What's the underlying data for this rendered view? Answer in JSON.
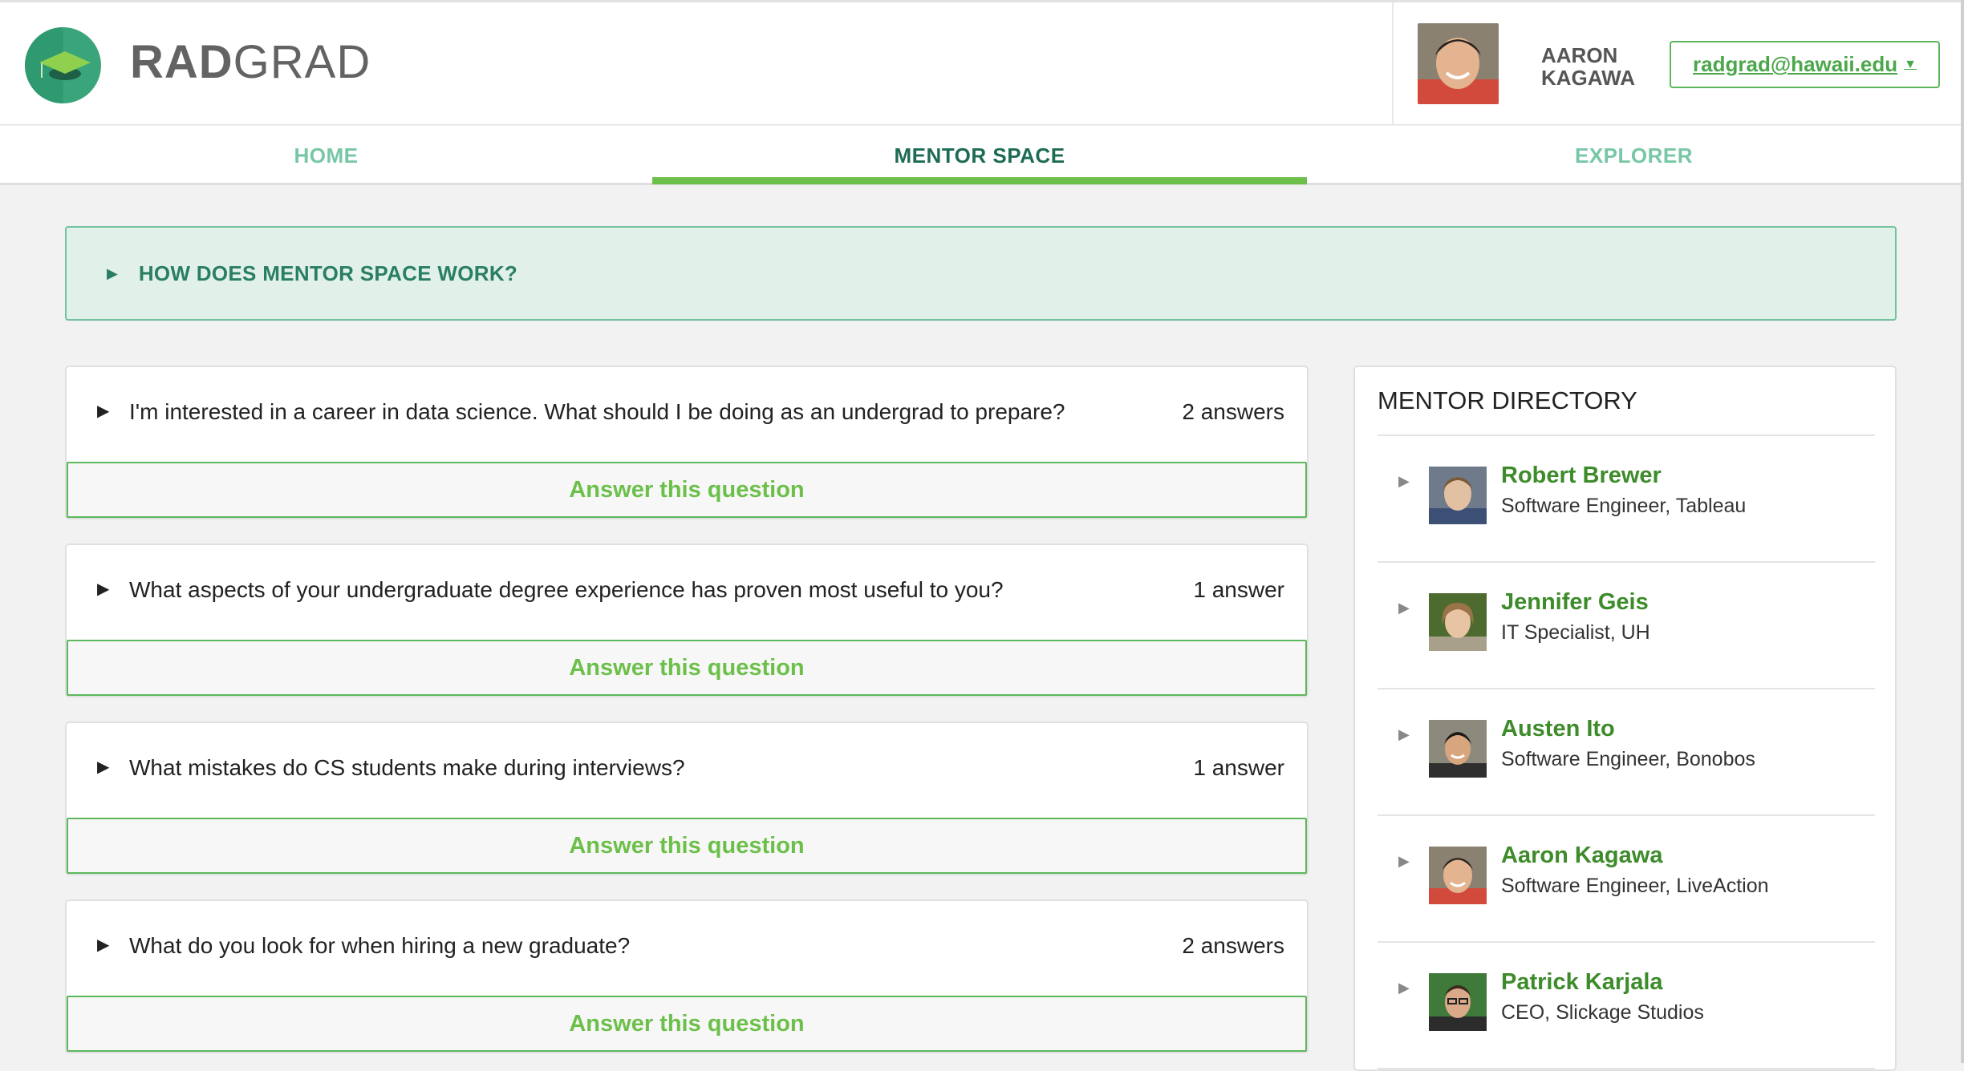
{
  "brand": {
    "name_bold": "RAD",
    "name_rest": "GRAD"
  },
  "user": {
    "name": "AARON\nKAGAWA",
    "email": "radgrad@hawaii.edu"
  },
  "tabs": [
    {
      "label": "HOME",
      "active": false
    },
    {
      "label": "MENTOR SPACE",
      "active": true
    },
    {
      "label": "EXPLORER",
      "active": false
    }
  ],
  "how": {
    "label": "HOW DOES MENTOR SPACE WORK?"
  },
  "questions": [
    {
      "text": "I'm interested in a career in data science. What should I be doing as an undergrad to prepare?",
      "count": "2 answers",
      "button": "Answer this question"
    },
    {
      "text": "What aspects of your undergraduate degree experience has proven most useful to you?",
      "count": "1 answer",
      "button": "Answer this question"
    },
    {
      "text": "What mistakes do CS students make during interviews?",
      "count": "1 answer",
      "button": "Answer this question"
    },
    {
      "text": "What do you look for when hiring a new graduate?",
      "count": "2 answers",
      "button": "Answer this question"
    }
  ],
  "directory": {
    "title": "MENTOR DIRECTORY",
    "mentors": [
      {
        "name": "Robert Brewer",
        "title": "Software Engineer, Tableau"
      },
      {
        "name": "Jennifer Geis",
        "title": "IT Specialist, UH"
      },
      {
        "name": "Austen Ito",
        "title": "Software Engineer, Bonobos"
      },
      {
        "name": "Aaron Kagawa",
        "title": "Software Engineer, LiveAction"
      },
      {
        "name": "Patrick Karjala",
        "title": "CEO, Slickage Studios"
      }
    ]
  },
  "colors": {
    "accent": "#6cc04a",
    "teal": "#2a7e63",
    "tab_inactive": "#77c7a6"
  }
}
